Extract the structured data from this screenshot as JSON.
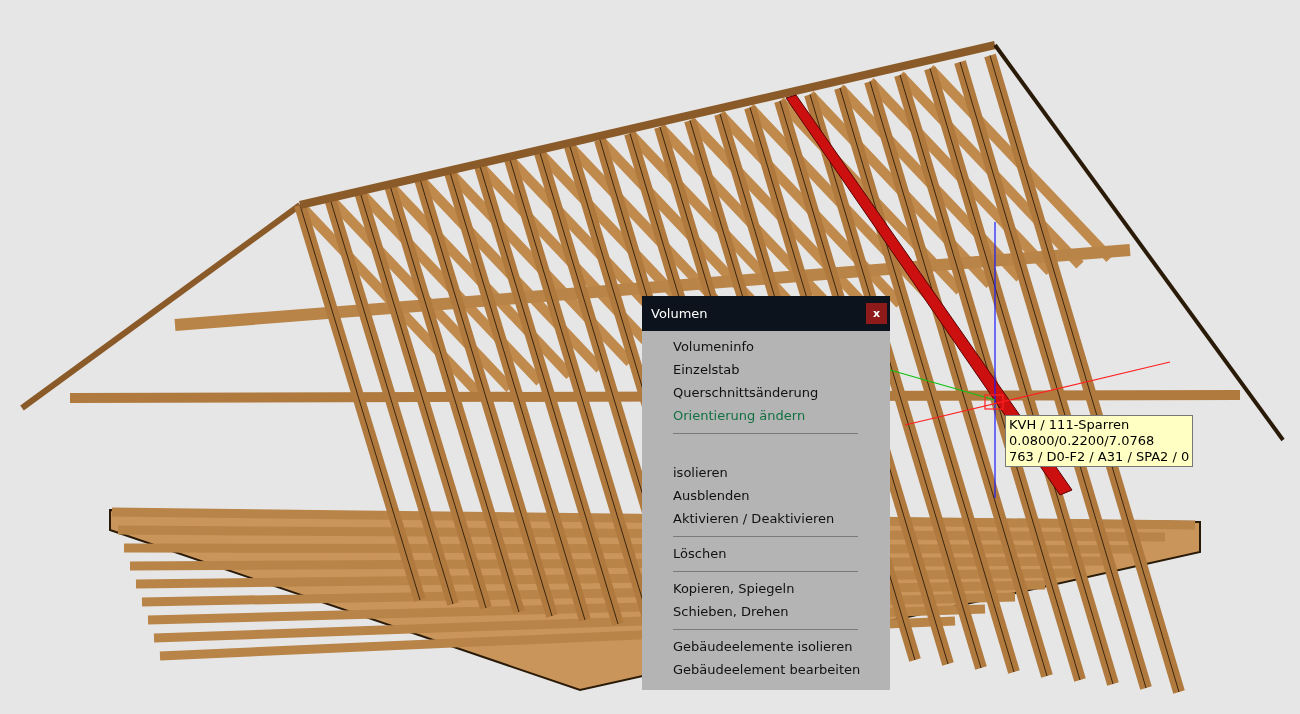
{
  "context_menu": {
    "title": "Volumen",
    "close_label": "x",
    "entries": [
      {
        "kind": "item",
        "label": "Volumeninfo",
        "selected": false
      },
      {
        "kind": "item",
        "label": "Einzelstab",
        "selected": false
      },
      {
        "kind": "item",
        "label": "Querschnittsänderung",
        "selected": false
      },
      {
        "kind": "item",
        "label": "Orientierung ändern",
        "selected": true
      },
      {
        "kind": "separator"
      },
      {
        "kind": "spacer"
      },
      {
        "kind": "item",
        "label": "isolieren",
        "selected": false
      },
      {
        "kind": "item",
        "label": "Ausblenden",
        "selected": false
      },
      {
        "kind": "item",
        "label": "Aktivieren / Deaktivieren",
        "selected": false
      },
      {
        "kind": "separator"
      },
      {
        "kind": "item",
        "label": "Löschen",
        "selected": false
      },
      {
        "kind": "separator"
      },
      {
        "kind": "item",
        "label": "Kopieren, Spiegeln",
        "selected": false
      },
      {
        "kind": "item",
        "label": "Schieben, Drehen",
        "selected": false
      },
      {
        "kind": "separator"
      },
      {
        "kind": "item",
        "label": "Gebäudeelemente isolieren",
        "selected": false
      },
      {
        "kind": "item",
        "label": "Gebäudeelement bearbeiten",
        "selected": false
      }
    ]
  },
  "tooltip": {
    "lines": [
      "KVH / 111-Sparren",
      "0.0800/0.2200/7.0768",
      "763 / D0-F2 / A31 / SPA2 / 0"
    ]
  }
}
